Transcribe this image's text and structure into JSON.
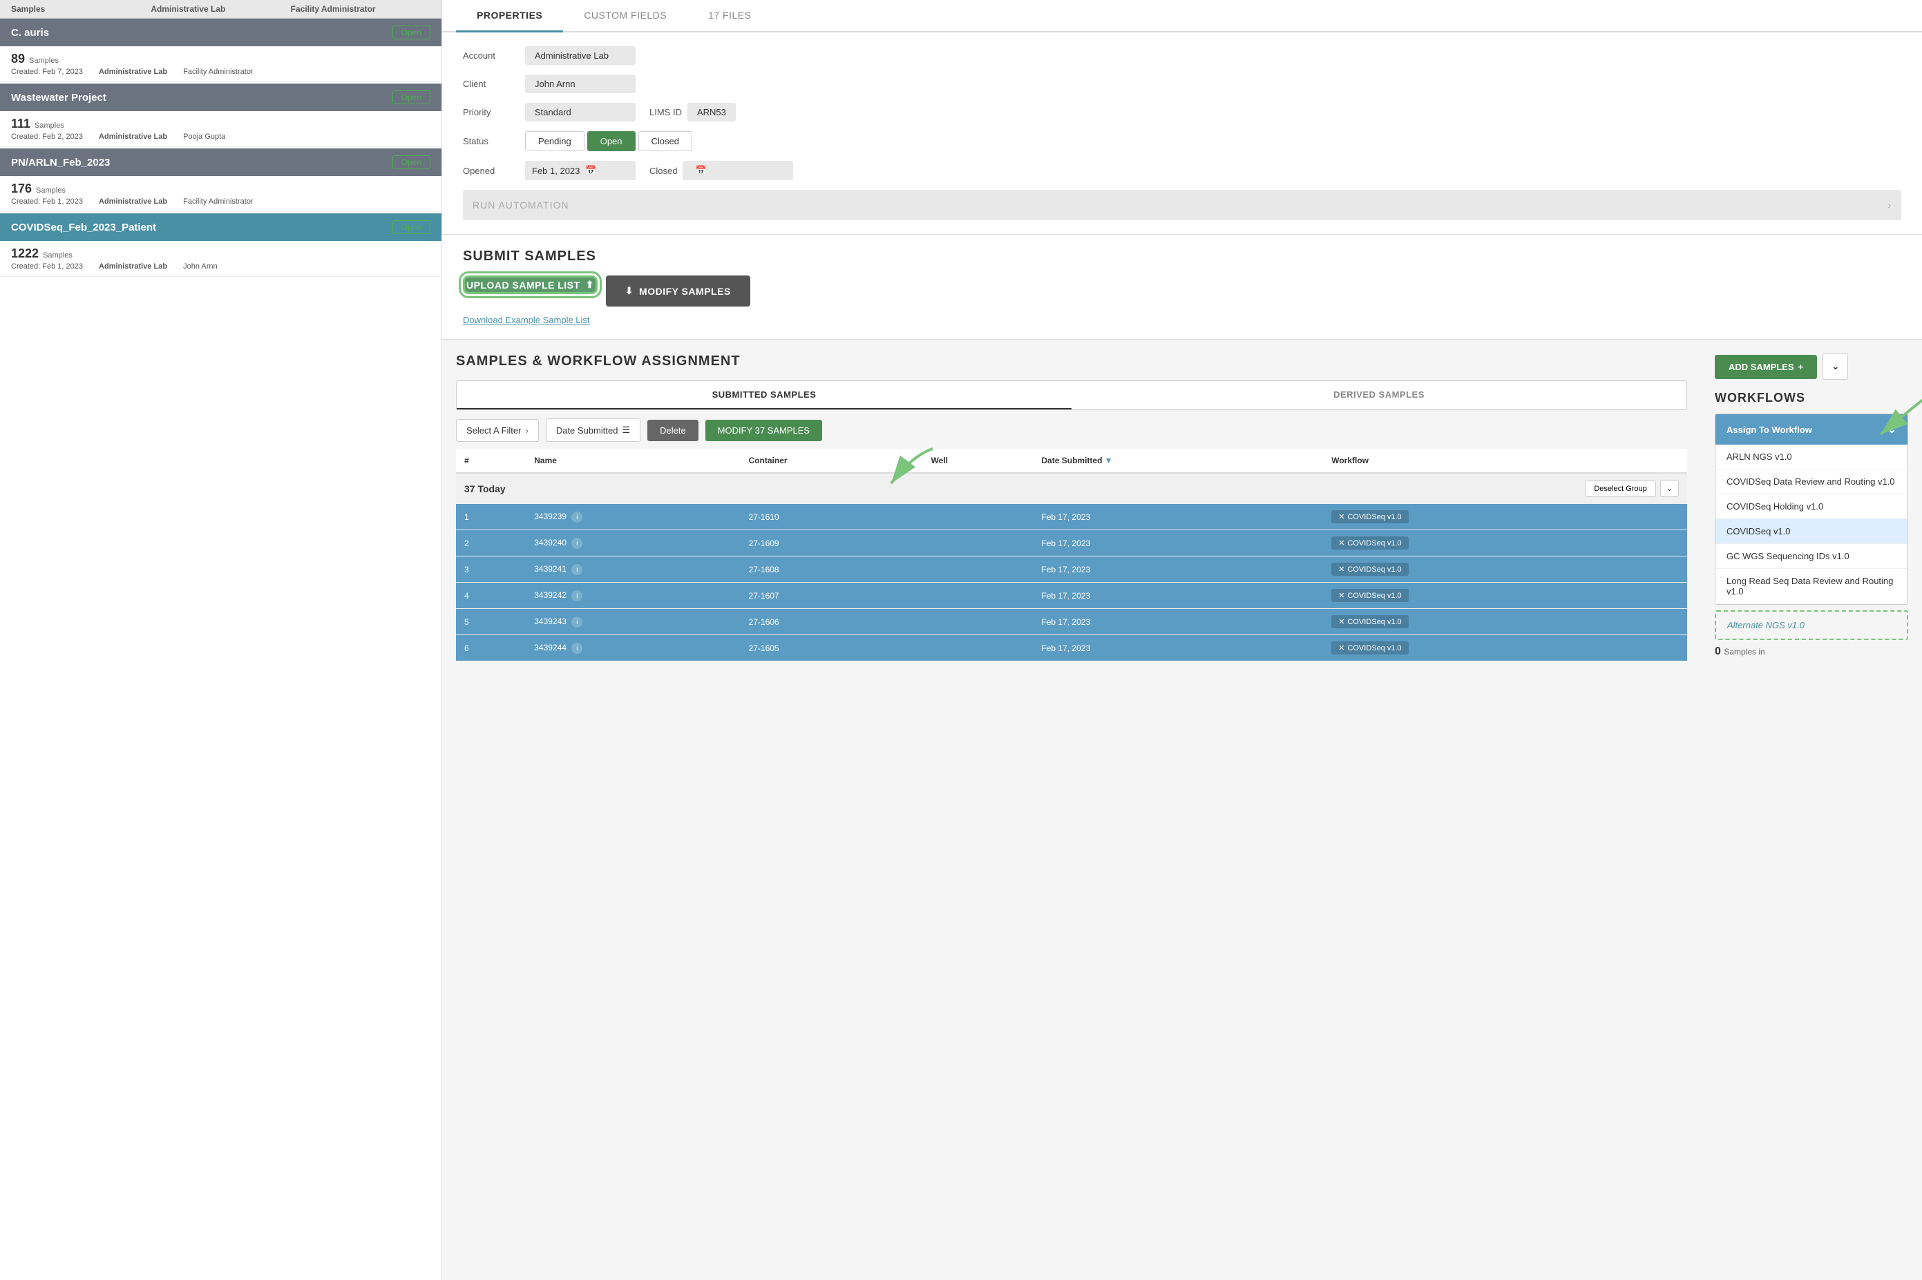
{
  "tabs": {
    "properties": "PROPERTIES",
    "custom_fields": "CUSTOM FIELDS",
    "files": "17 FILES"
  },
  "properties": {
    "account_label": "Account",
    "account_value": "Administrative Lab",
    "client_label": "Client",
    "client_value": "John Arnn",
    "priority_label": "Priority",
    "priority_value": "Standard",
    "lims_id_label": "LIMS ID",
    "lims_id_value": "ARN53",
    "status_label": "Status",
    "status_pending": "Pending",
    "status_open": "Open",
    "status_closed": "Closed",
    "opened_label": "Opened",
    "opened_value": "Feb 1, 2023",
    "closed_label": "Closed",
    "run_automation": "RUN AUTOMATION"
  },
  "submit_samples": {
    "title": "SUBMIT SAMPLES",
    "upload_btn": "UPLOAD SAMPLE LIST",
    "modify_btn": "MODIFY SAMPLES",
    "download_link": "Download Example Sample List"
  },
  "top_header": {
    "samples": "Samples",
    "admin_lab": "Administrative Lab",
    "facility_admin": "Facility Administrator"
  },
  "projects": [
    {
      "name": "C. auris",
      "status": "Open",
      "samples_count": "89",
      "samples_label": "Samples",
      "created": "Created: Feb 7, 2023",
      "lab": "Administrative Lab",
      "user": "Facility Administrator"
    },
    {
      "name": "Wastewater Project",
      "status": "Open",
      "samples_count": "111",
      "samples_label": "Samples",
      "created": "Created: Feb 2, 2023",
      "lab": "Administrative Lab",
      "user": "Pooja Gupta"
    },
    {
      "name": "PN/ARLN_Feb_2023",
      "status": "Open",
      "samples_count": "176",
      "samples_label": "Samples",
      "created": "Created: Feb 1, 2023",
      "lab": "Administrative Lab",
      "user": "Facility Administrator"
    },
    {
      "name": "COVIDSeq_Feb_2023_Patient",
      "status": "Open",
      "samples_count": "1222",
      "samples_label": "Samples",
      "created": "Created: Feb 1, 2023",
      "lab": "Administrative Lab",
      "user": "John Arnn",
      "selected": true
    }
  ],
  "samples_workflow": {
    "section_title": "SAMPLES & WORKFLOW ASSIGNMENT",
    "sub_tab_submitted": "SUBMITTED SAMPLES",
    "sub_tab_derived": "DERIVED SAMPLES",
    "filter_placeholder": "Select A Filter",
    "date_filter": "Date Submitted",
    "delete_btn": "Delete",
    "modify_samples_btn": "MODIFY 37 SAMPLES",
    "table_headers": [
      "#",
      "Name",
      "Container",
      "Well",
      "Date Submitted",
      "Workflow"
    ],
    "group_label": "37 Today",
    "deselect_btn": "Deselect Group",
    "samples": [
      {
        "num": "1",
        "name": "3439239",
        "container": "27-1610",
        "well": "",
        "date": "Feb 17, 2023",
        "workflow": "COVIDSeq v1.0"
      },
      {
        "num": "2",
        "name": "3439240",
        "container": "27-1609",
        "well": "",
        "date": "Feb 17, 2023",
        "workflow": "COVIDSeq v1.0"
      },
      {
        "num": "3",
        "name": "3439241",
        "container": "27-1608",
        "well": "",
        "date": "Feb 17, 2023",
        "workflow": "COVIDSeq v1.0"
      },
      {
        "num": "4",
        "name": "3439242",
        "container": "27-1607",
        "well": "",
        "date": "Feb 17, 2023",
        "workflow": "COVIDSeq v1.0"
      },
      {
        "num": "5",
        "name": "3439243",
        "container": "27-1606",
        "well": "",
        "date": "Feb 17, 2023",
        "workflow": "COVIDSeq v1.0"
      },
      {
        "num": "6",
        "name": "3439244",
        "container": "27-1605",
        "well": "",
        "date": "Feb 17, 2023",
        "workflow": "COVIDSeq v1.0"
      }
    ]
  },
  "workflows": {
    "title": "WORKFLOWS",
    "add_samples_btn": "ADD SAMPLES",
    "assign_dropdown": "Assign To Workflow",
    "workflow_items": [
      {
        "label": "ARLN NGS v1.0",
        "highlighted": false
      },
      {
        "label": "COVIDSeq Data Review and Routing v1.0",
        "highlighted": false
      },
      {
        "label": "COVIDSeq Holding v1.0",
        "highlighted": false
      },
      {
        "label": "COVIDSeq v1.0",
        "highlighted": false,
        "selected": true
      },
      {
        "label": "GC WGS Sequencing IDs v1.0",
        "highlighted": false
      },
      {
        "label": "Long Read Seq Data Review and Routing v1.0",
        "highlighted": false
      },
      {
        "label": "Alternate NGS v1.0",
        "highlighted": true
      }
    ]
  },
  "colors": {
    "teal": "#4a90a4",
    "green": "#4a8c50",
    "blue_row": "#5b9cc4",
    "gray_header": "#6b7280",
    "selected_header": "#4a90a4",
    "green_annotation": "#7bc47b"
  }
}
